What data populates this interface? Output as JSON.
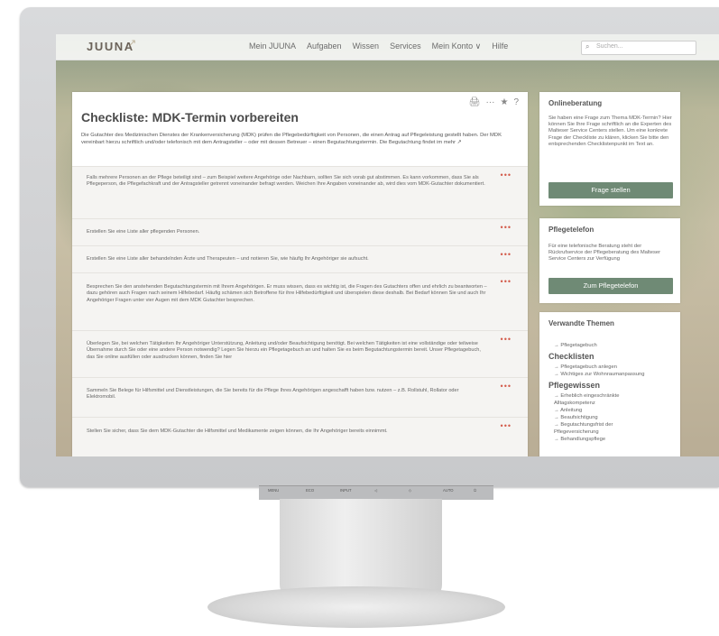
{
  "topbar": {
    "logo": "JUUNA",
    "logo_mark": "↗",
    "nav": [
      "Mein JUUNA",
      "Aufgaben",
      "Wissen",
      "Services",
      "Mein Konto ∨",
      "Hilfe"
    ],
    "search_placeholder": "Suchen..."
  },
  "main": {
    "tools": [
      "🖨",
      "···",
      "★",
      "?"
    ],
    "title": "Checkliste: MDK-Termin vorbereiten",
    "intro": "Die Gutachter des Medizinischen Dienstes der Krankenversicherung (MDK) prüfen die Pflegebedürftigkeit von Personen, die einen Antrag auf Pflegeleistung gestellt haben. Der MDK vereinbart hierzu schriftlich und/oder telefonisch mit dem Antragsteller – oder mit dessen Betreuer – einen Begutachtungstermin. Die Begutachtung findet im mehr ↗",
    "items": [
      "Falls mehrere Personen an der Pflege beteiligt sind – zum Beispiel weitere Angehörige oder Nachbarn, sollten Sie sich vorab gut abstimmen. Es kann vorkommen, dass Sie als Pflegeperson, die Pflegefachkraft und der Antragsteller getrennt voneinander befragt werden. Weichen Ihre Angaben voneinander ab, wird dies vom MDK-Gutachter dokumentiert.",
      "Erstellen Sie eine Liste aller pflegenden Personen.",
      "Erstellen Sie eine Liste aller behandelnden Ärzte und Therapeuten – und notieren Sie, wie häufig Ihr Angehöriger sie aufsucht.",
      "Besprechen Sie den anstehenden Begutachtungstermin mit Ihrem Angehörigen. Er muss wissen, dass es wichtig ist, die Fragen des Gutachters offen und ehrlich zu beantworten – dazu gehören auch Fragen nach seinem Hilfebedarf. Häufig schämen sich Betroffene für ihre Hilfebedürftigkeit und überspielen diese deshalb. Bei Bedarf können Sie und auch Ihr Angehöriger Fragen unter vier Augen mit dem MDK Gutachter besprechen.",
      "Überlegen Sie, bei welchen Tätigkeiten Ihr Angehöriger Unterstützung, Anleitung und/oder Beaufsichtigung benötigt. Bei welchen Tätigkeiten ist eine vollständige oder teilweise Übernahme durch Sie oder eine andere Person notwendig? Legen Sie hierzu ein Pflegetagebuch an und halten Sie es beim Begutachtungstermin bereit. Unser Pflegetagebuch, das Sie online ausfüllen oder ausdrucken können, finden Sie hier",
      "Sammeln Sie Belege für Hilfsmittel und Dienstleistungen, die Sie bereits für die Pflege Ihres Angehörigen angeschafft haben bzw. nutzen – z.B. Rollstuhl, Rollator oder Elektromobil.",
      "Stellen Sie sicher, dass Sie dem MDK-Gutachter die Hilfsmittel und Medikamente zeigen können, die Ihr Angehöriger bereits einnimmt."
    ],
    "item_menu": "•••"
  },
  "sidebar": {
    "online": {
      "title": "Onlineberatung",
      "text": "Sie haben eine Frage zum Thema MDK-Termin? Hier können Sie Ihre Frage schriftlich an die Experten des Malteser Service Centers stellen. Um eine konkrete Frage der Checkliste zu klären, klicken Sie bitte den entsprechenden Checklistenpunkt im Text an.",
      "button": "Frage stellen"
    },
    "phone": {
      "title": "Pflegetelefon",
      "text": "Für eine telefonische Beratung steht der Rückrufservice der Pflegeberatung des Malteser Service Centers zur Verfügung",
      "button": "Zum Pflegetelefon"
    },
    "related": {
      "title": "Verwandte Themen",
      "top_links": [
        "→  Pflegetagebuch"
      ],
      "checklists_title": "Checklisten",
      "checklists": [
        "→  Pflegetagebuch anlegen",
        "→  Wichtiges zur Wohnraumanpassung"
      ],
      "knowledge_title": "Pflegewissen",
      "knowledge": [
        "→  Erheblich eingeschränkte",
        "    Alltagskompetenz",
        "→  Anleitung",
        "→  Beaufsichtigung",
        "→  Begutachtungsfrist der",
        "    Pflegeversicherung",
        "→  Behandlungspflege"
      ]
    }
  },
  "controls": [
    "MENU",
    "ECO",
    "INPUT",
    "◁",
    "◇",
    "AUTO",
    "⏻"
  ]
}
